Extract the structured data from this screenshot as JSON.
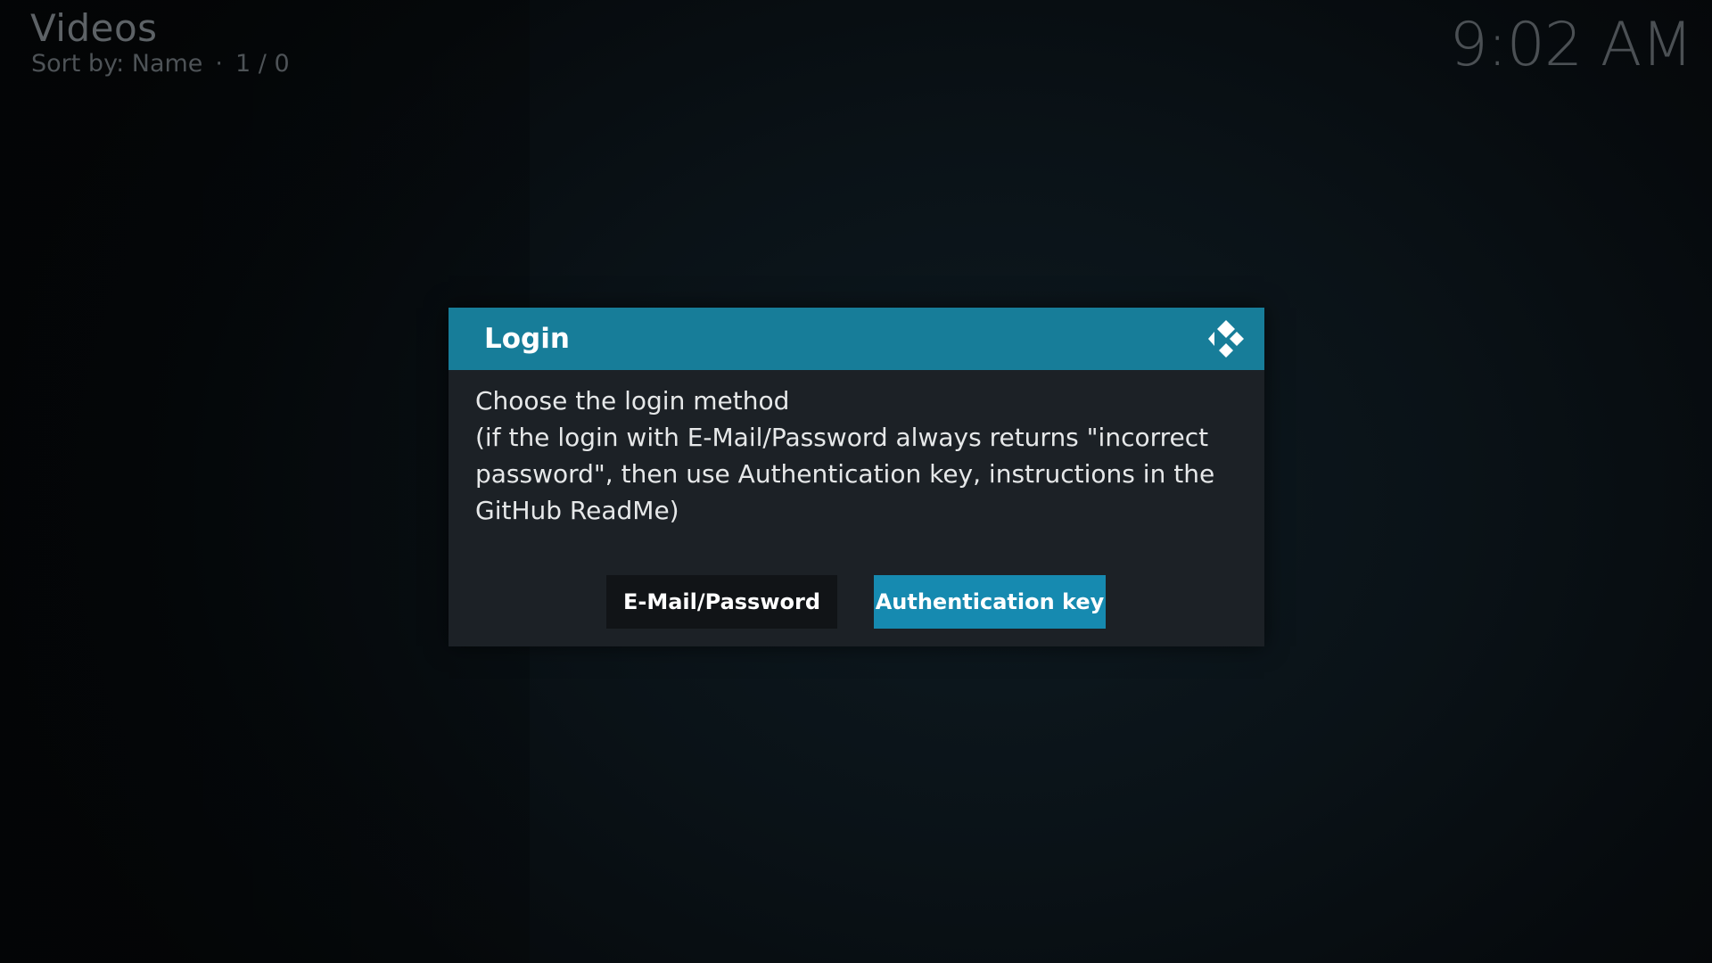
{
  "header": {
    "title": "Videos",
    "sort_label": "Sort by: Name",
    "separator": "·",
    "position": "1 / 0"
  },
  "clock": "9:02 AM",
  "dialog": {
    "title": "Login",
    "logo_icon": "kodi-logo-icon",
    "lines": [
      "Choose the login method",
      "(if the login with E-Mail/Password always returns \"incorrect",
      "password\", then use Authentication key, instructions in the",
      "GitHub ReadMe)"
    ],
    "buttons": {
      "email": "E-Mail/Password",
      "auth": "Authentication key"
    }
  },
  "colors": {
    "dialog_header": "#177d99",
    "dialog_body": "#1c2126",
    "focused_button": "#168ab0",
    "unfocused_button": "#111417"
  }
}
